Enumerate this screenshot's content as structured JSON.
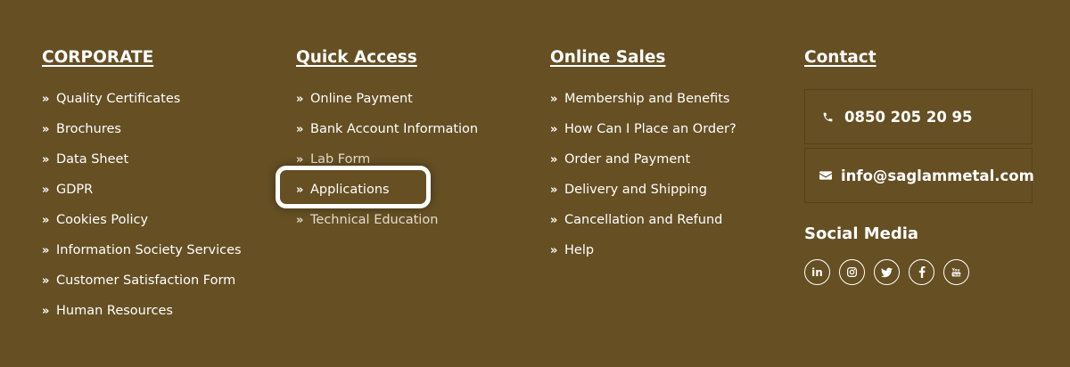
{
  "theme": {
    "background": "#654f23",
    "text": "#ffffff",
    "highlight_border": "#ffffff"
  },
  "corporate": {
    "heading": "CORPORATE",
    "items": [
      "Quality Certificates",
      "Brochures",
      "Data Sheet",
      "GDPR",
      "Cookies Policy",
      "Information Society Services",
      "Customer Satisfaction Form",
      "Human Resources"
    ]
  },
  "quick_access": {
    "heading": "Quick Access",
    "items": [
      "Online Payment",
      "Bank Account Information",
      "Lab Form",
      "Applications",
      "Technical Education"
    ],
    "highlighted_item": "Applications"
  },
  "online_sales": {
    "heading": "Online Sales",
    "items": [
      "Membership and Benefits",
      "How Can I Place an Order?",
      "Order and Payment",
      "Delivery and Shipping",
      "Cancellation and Refund",
      "Help"
    ]
  },
  "contact": {
    "heading": "Contact",
    "phone": "0850 205 20 95",
    "email": "info@saglammetal.com",
    "phone_icon": "phone-icon",
    "email_icon": "envelope-icon"
  },
  "social": {
    "title": "Social Media",
    "icons": [
      "linkedin-icon",
      "instagram-icon",
      "twitter-icon",
      "facebook-icon",
      "youtube-icon"
    ]
  }
}
